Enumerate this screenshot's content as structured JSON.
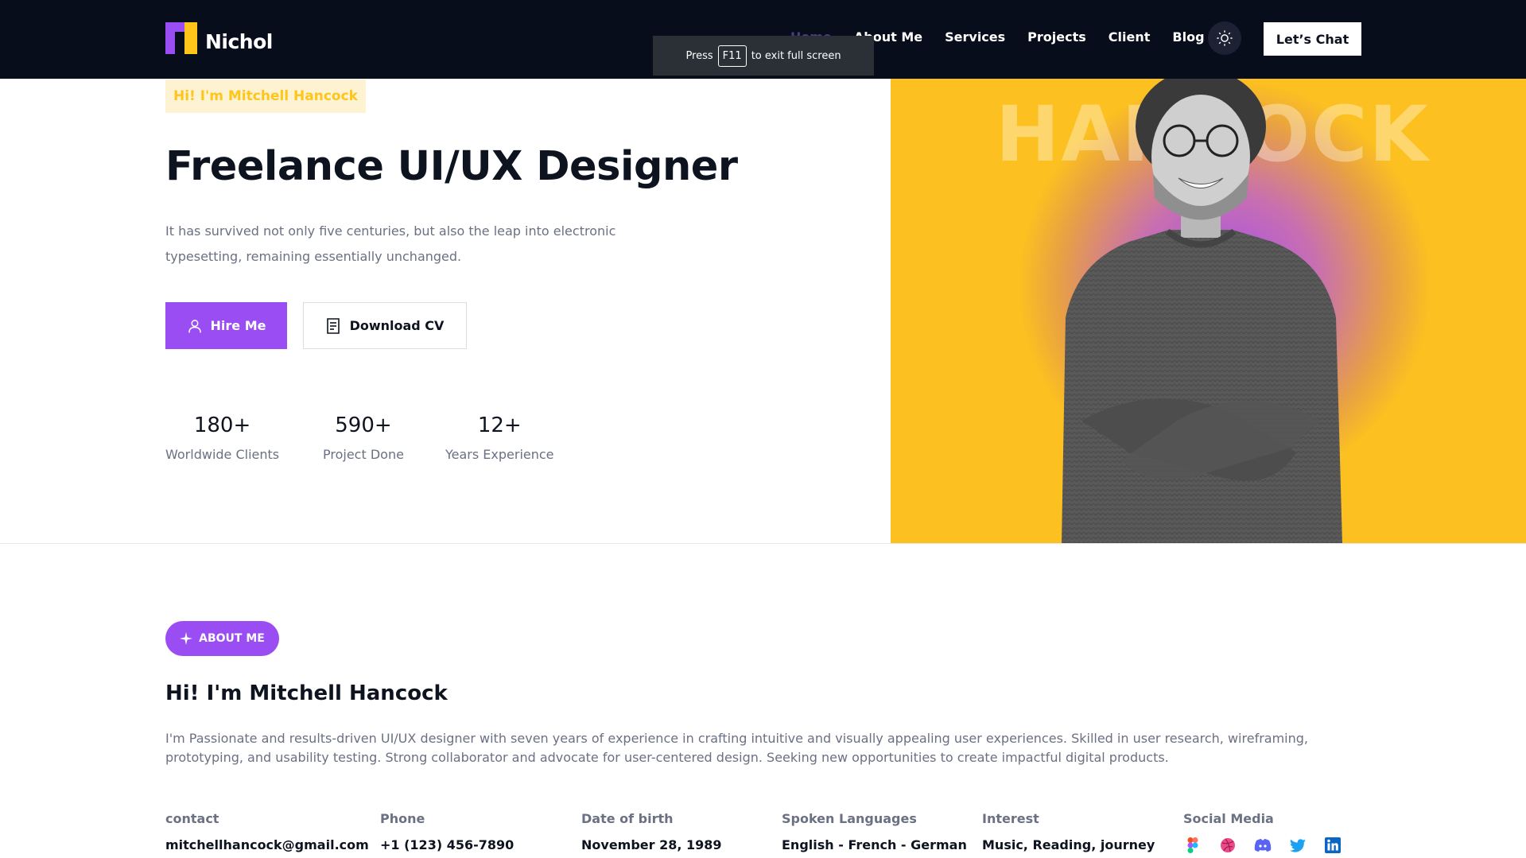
{
  "brand": {
    "name": "Nichol"
  },
  "nav": {
    "items": [
      {
        "label": "Home"
      },
      {
        "label": "About Me"
      },
      {
        "label": "Services"
      },
      {
        "label": "Projects"
      },
      {
        "label": "Client"
      },
      {
        "label": "Blog"
      }
    ],
    "theme_icon": "sun-icon",
    "cta_label": "Let’s Chat"
  },
  "fullscreen_toast": {
    "prefix": "Press",
    "key": "F11",
    "suffix": "to exit full screen"
  },
  "hero": {
    "tag": "Hi! I'm Mitchell Hancock",
    "title": "Freelance UI/UX Designer",
    "description": "It has survived not only five centuries, but also the leap into electronic typesetting, remaining essentially unchanged.",
    "hire_label": "Hire Me",
    "cv_label": "Download CV",
    "background_text": "HANCOCK",
    "stats": [
      {
        "value": "180+",
        "label": "Worldwide Clients"
      },
      {
        "value": "590+",
        "label": "Project Done"
      },
      {
        "value": "12+",
        "label": "Years Experience"
      }
    ]
  },
  "about": {
    "pill_label": "ABOUT ME",
    "title": "Hi! I'm Mitchell Hancock",
    "description": "I'm Passionate and results-driven UI/UX designer with seven years of experience in crafting intuitive and visually appealing user experiences. Skilled in user research, wireframing, prototyping, and usability testing. Strong collaborator and advocate for user-centered design. Seeking new opportunities to create impactful digital products.",
    "info": [
      {
        "label": "contact",
        "value": "mitchellhancock@gmail.com"
      },
      {
        "label": "Phone",
        "value": "+1 (123) 456-7890"
      },
      {
        "label": "Date of birth",
        "value": "November 28, 1989"
      },
      {
        "label": "Spoken Languages",
        "value": "English - French - German"
      },
      {
        "label": "Interest",
        "value": "Music, Reading, journey"
      }
    ],
    "social_label": "Social Media",
    "socials": [
      "figma-icon",
      "dribbble-icon",
      "discord-icon",
      "twitter-icon",
      "linkedin-icon"
    ]
  },
  "colors": {
    "accent": "#9a4df2",
    "yellow": "#ffc51a",
    "header_bg": "#070d1b"
  }
}
